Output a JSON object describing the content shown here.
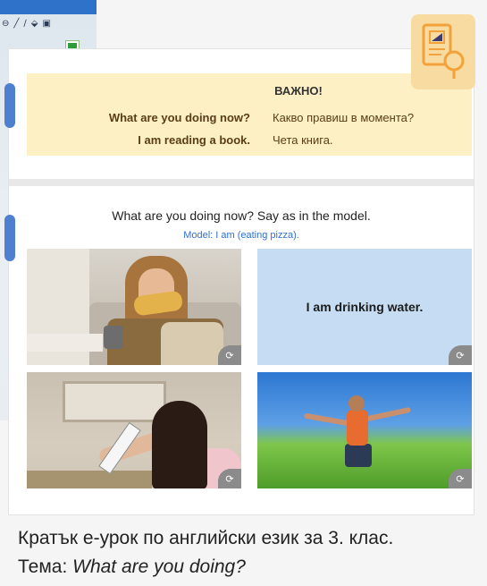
{
  "background_window": {
    "toolbar_icons": [
      "circle-icon",
      "pencil-icon",
      "pen-icon",
      "eraser-icon",
      "save-icon"
    ],
    "toolbar_glyphs": [
      "⊖",
      "╱",
      "∕",
      "⬙",
      "▣"
    ]
  },
  "important": {
    "title": "ВАЖНО!",
    "en_question": "What are you doing now?",
    "en_answer": "I am reading a book.",
    "bg_question": "Какво правиш в момента?",
    "bg_answer": "Чета книга."
  },
  "exercise": {
    "instruction": "What are you doing now? Say as in the model.",
    "model": "Model: I am (eating pizza).",
    "tiles": [
      {
        "kind": "image",
        "subject": "girl eating pizza"
      },
      {
        "kind": "text",
        "text": "I am drinking water."
      },
      {
        "kind": "image",
        "subject": "girl watching tv"
      },
      {
        "kind": "image",
        "subject": "boy running in field"
      }
    ],
    "refresh_icon": "refresh-icon",
    "refresh_glyph": "⟳"
  },
  "caption": {
    "line1": "Кратък е-урок по английски език за 3. клас.",
    "line2_prefix": "Тема: ",
    "line2_topic": "What are you doing?"
  },
  "colors": {
    "accent_blue": "#4f7fcf",
    "important_bg": "#fcf0c4",
    "text_tile_bg": "#c6dcf2",
    "model_text": "#2f6fd4",
    "icon_bg": "#f8dba0",
    "icon_stroke": "#f2a23b"
  }
}
